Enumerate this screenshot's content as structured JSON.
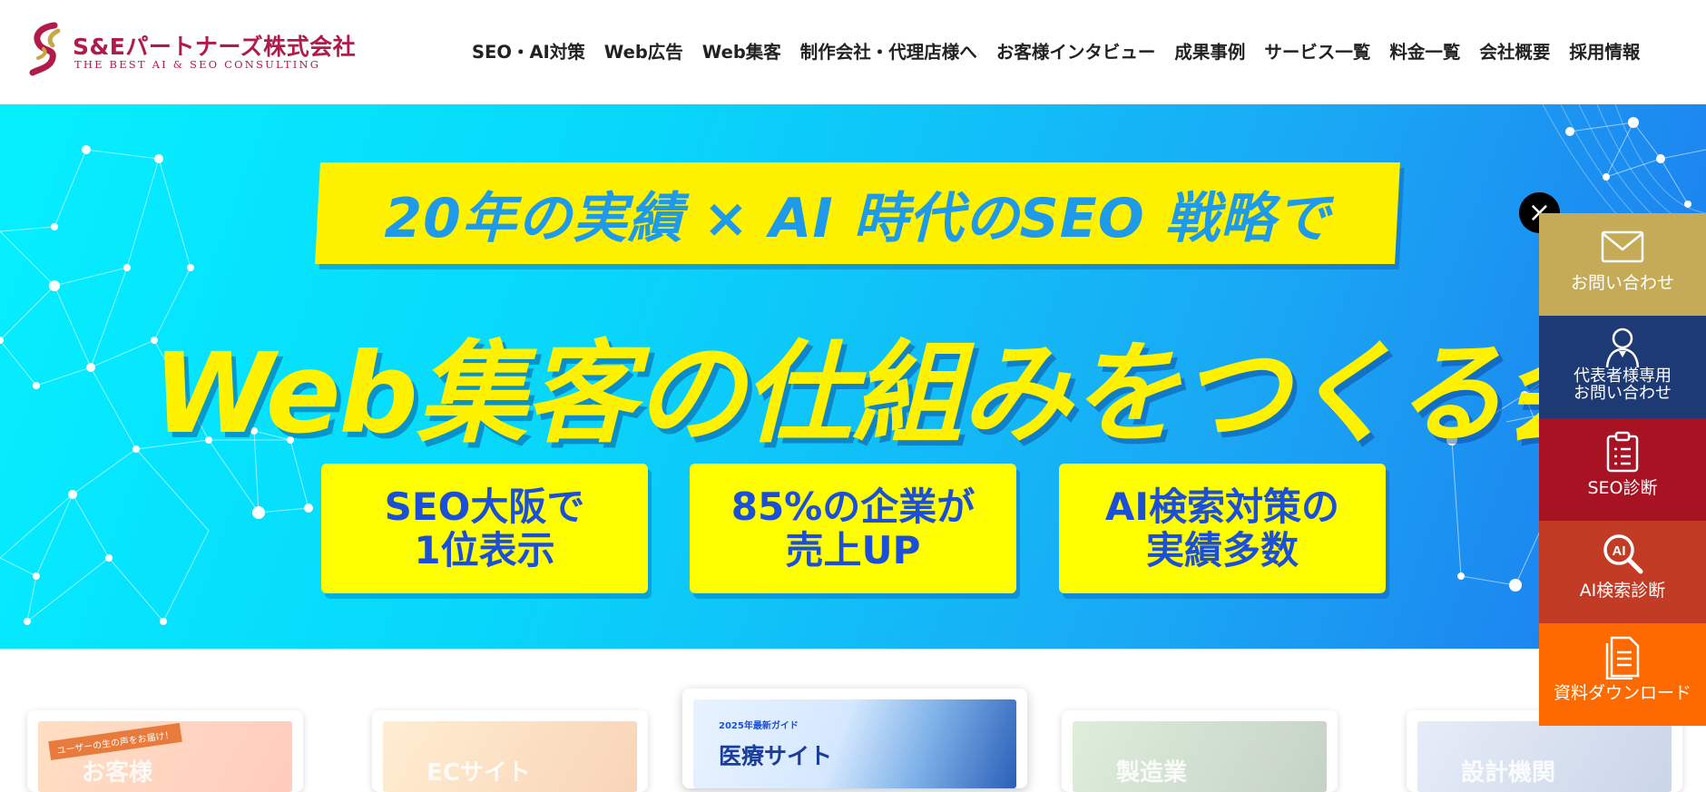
{
  "header": {
    "logo_name": "S&Eパートナーズ株式会社",
    "logo_tagline": "THE BEST AI & SEO CONSULTING",
    "nav": [
      {
        "label": "SEO・AI対策"
      },
      {
        "label": "Web広告"
      },
      {
        "label": "Web集客"
      },
      {
        "label": "制作会社・代理店様へ"
      },
      {
        "label": "お客様インタビュー"
      },
      {
        "label": "成果事例"
      },
      {
        "label": "サービス一覧"
      },
      {
        "label": "料金一覧"
      },
      {
        "label": "会社概要"
      },
      {
        "label": "採用情報"
      }
    ]
  },
  "hero": {
    "banner": "20年の実績 × AI 時代のSEO 戦略で",
    "headline": "Web集客の仕組みをつくる会社",
    "features": [
      {
        "text": "SEO大阪で\n1位表示"
      },
      {
        "text": "85%の企業が\n売上UP"
      },
      {
        "text": "AI検索対策の\n実績多数"
      }
    ]
  },
  "cards": {
    "items": [
      {
        "ribbon": "ユーザーの生の声をお届け！",
        "title": "お客様"
      },
      {
        "title": "ECサイト"
      },
      {
        "kicker": "2025年最新ガイド",
        "title": "医療サイト"
      },
      {
        "title": "製造業"
      },
      {
        "title": "設計機関"
      }
    ]
  },
  "side_cta": {
    "close_symbol": "×",
    "items": [
      {
        "label": "お問い合わせ",
        "icon": "mail-icon",
        "color": "#c5aa58"
      },
      {
        "label": "代表者様専用\nお問い合わせ",
        "icon": "person-icon",
        "color": "#1e3a75"
      },
      {
        "label": "SEO診断",
        "icon": "clipboard-icon",
        "color": "#a81324"
      },
      {
        "label": "AI検索診断",
        "icon": "ai-search-icon",
        "color": "#c23b25"
      },
      {
        "label": "資料ダウンロード",
        "icon": "document-icon",
        "color": "#ff6a00"
      }
    ]
  }
}
